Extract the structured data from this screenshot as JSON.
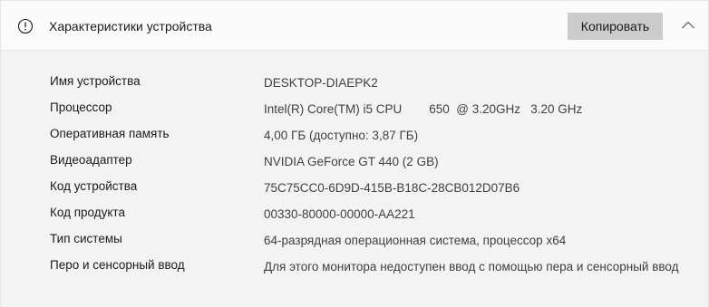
{
  "header": {
    "title": "Характеристики устройства",
    "copy_label": "Копировать"
  },
  "specs": [
    {
      "label": "Имя устройства",
      "value": "DESKTOP-DIAEPK2"
    },
    {
      "label": "Процессор",
      "value": "Intel(R) Core(TM) i5 CPU        650  @ 3.20GHz   3.20 GHz"
    },
    {
      "label": "Оперативная память",
      "value": "4,00 ГБ (доступно: 3,87 ГБ)"
    },
    {
      "label": "Видеоадаптер",
      "value": "NVIDIA GeForce GT 440 (2 GB)"
    },
    {
      "label": "Код устройства",
      "value": "75C75CC0-6D9D-415B-B18C-28CB012D07B6"
    },
    {
      "label": "Код продукта",
      "value": "00330-80000-00000-AA221"
    },
    {
      "label": "Тип системы",
      "value": "64-разрядная операционная система, процессор x64"
    },
    {
      "label": "Перо и сенсорный ввод",
      "value": "Для этого монитора недоступен ввод с помощью пера и сенсорный ввод"
    }
  ],
  "icons": {
    "header_icon": "info-icon",
    "collapse_icon": "chevron-up-icon"
  },
  "colors": {
    "header_bg": "#fbfbfb",
    "body_bg": "#f3f3f3",
    "button_bg": "#cccccc"
  }
}
